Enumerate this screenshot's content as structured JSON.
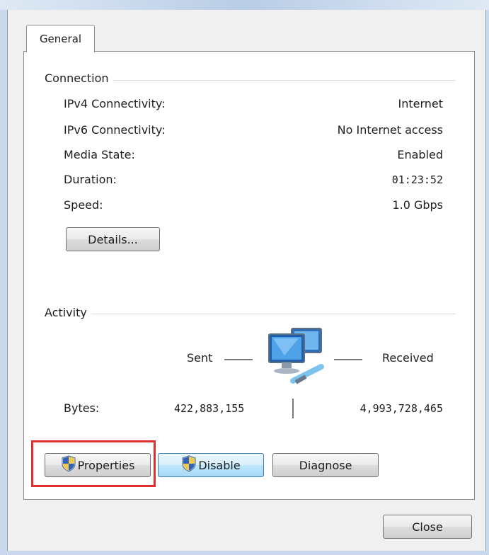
{
  "tabs": [
    {
      "label": "General"
    }
  ],
  "connection": {
    "section_label": "Connection",
    "rows": [
      {
        "label": "IPv4 Connectivity:",
        "value": "Internet"
      },
      {
        "label": "IPv6 Connectivity:",
        "value": "No Internet access"
      },
      {
        "label": "Media State:",
        "value": "Enabled"
      },
      {
        "label": "Duration:",
        "value": "01:23:52"
      },
      {
        "label": "Speed:",
        "value": "1.0 Gbps"
      }
    ],
    "details_button": "Details..."
  },
  "activity": {
    "section_label": "Activity",
    "sent_label": "Sent",
    "received_label": "Received",
    "bytes_label": "Bytes:",
    "bytes_sent": "422,883,155",
    "bytes_received": "4,993,728,465"
  },
  "actions": {
    "properties": "Properties",
    "disable": "Disable",
    "diagnose": "Diagnose"
  },
  "footer": {
    "close": "Close"
  },
  "colors": {
    "highlight": "#e0302f",
    "focused_button": "#a7d9f5"
  },
  "icons": [
    "shield-icon",
    "network-computers-icon"
  ]
}
